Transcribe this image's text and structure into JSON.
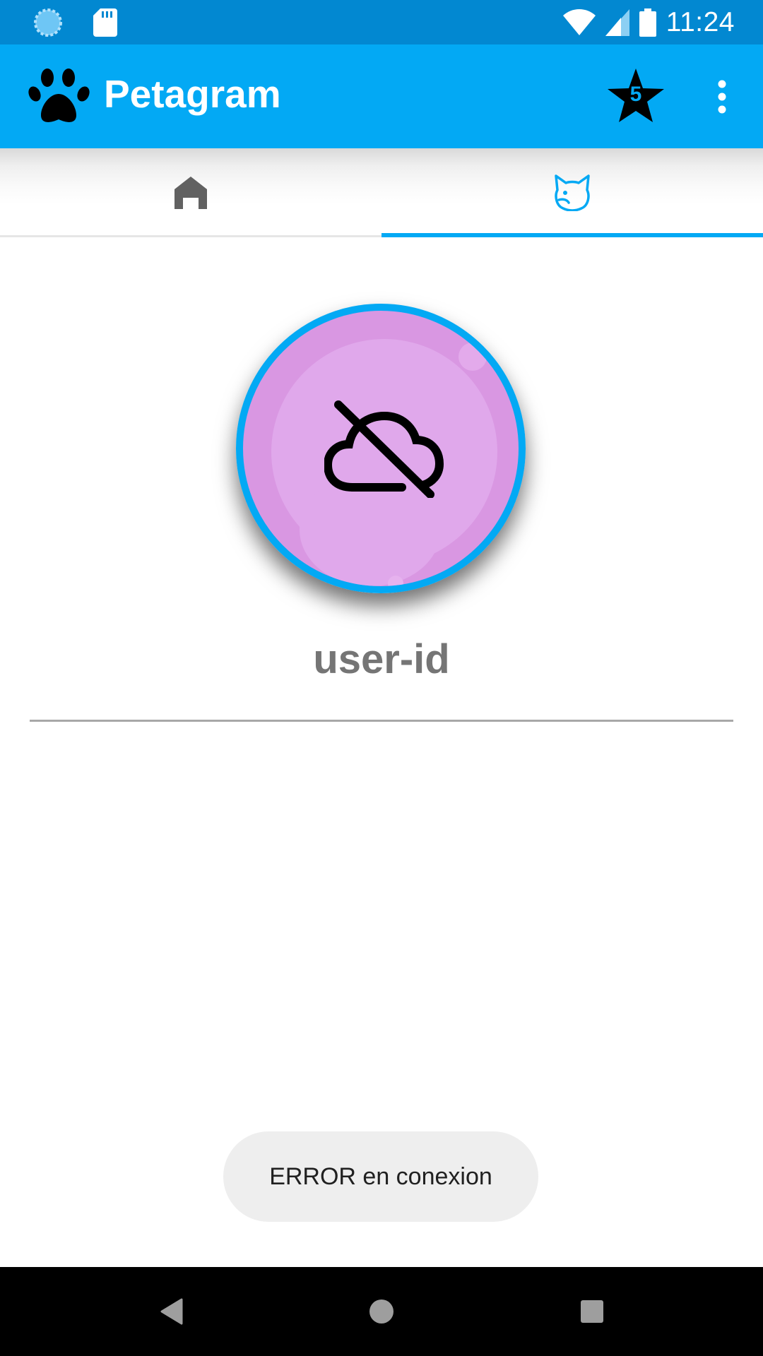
{
  "status_bar": {
    "time": "11:24",
    "icons": [
      "sync-icon",
      "sd-card-icon",
      "wifi-icon",
      "cell-signal-icon",
      "battery-icon"
    ]
  },
  "app_bar": {
    "title": "Petagram",
    "logo_icon": "paw-icon",
    "favorites_count": "5",
    "overflow_icon": "more-vert-icon"
  },
  "tabs": [
    {
      "icon": "home-icon",
      "selected": false
    },
    {
      "icon": "dog-face-icon",
      "selected": true
    }
  ],
  "profile": {
    "avatar_icon": "cloud-off-icon",
    "user_id": "user-id"
  },
  "toast": {
    "message": "ERROR en conexion"
  },
  "nav_bar": {
    "buttons": [
      "back-icon",
      "home-circle-icon",
      "recents-icon"
    ]
  },
  "colors": {
    "status_bar": "#0288d1",
    "primary": "#03a9f4",
    "avatar_bg": "#d997e2",
    "text_gray": "#757575"
  }
}
